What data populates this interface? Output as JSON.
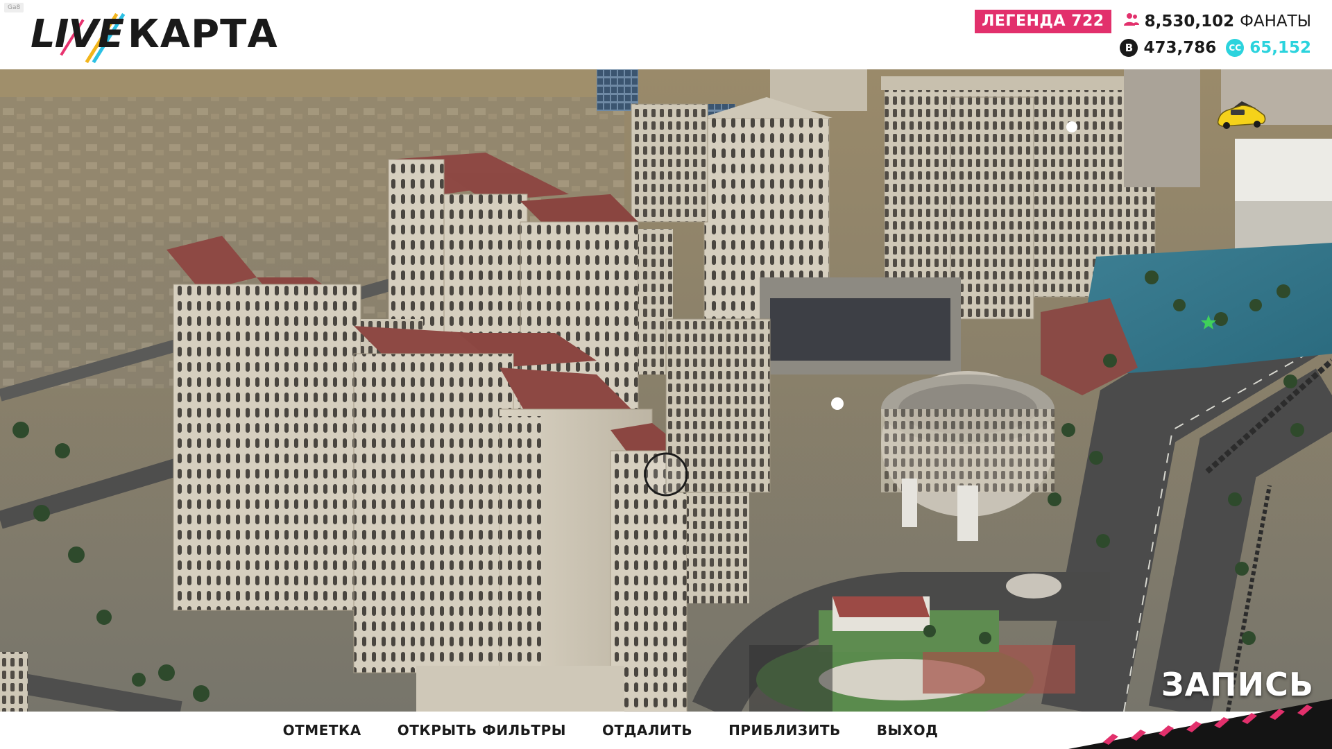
{
  "header": {
    "build_tag": "Ga8",
    "logo": {
      "part1": "LIVE",
      "part2": "КАРТА"
    },
    "legend_badge": "ЛЕГЕНДА 722",
    "fans": {
      "icon": "people-icon",
      "value": "8,530,102",
      "label": "ФАНАТЫ"
    },
    "bucks": {
      "icon": "bucks-coin-icon",
      "value": "473,786"
    },
    "crew_credits": {
      "icon": "cc-coin-icon",
      "badge": "CC",
      "value": "65,152"
    }
  },
  "map": {
    "player_vehicle_icon": "yellow-car-icon",
    "markers": [
      "waypoint-white-dot",
      "waypoint-white-dot",
      "green-star-icon",
      "circle-cursor-icon"
    ],
    "accent_colors": {
      "brand_pink": "#e2306c",
      "cc_cyan": "#2bd3dd",
      "vehicle": "#f5d21a"
    }
  },
  "recording_label": "ЗАПИСЬ",
  "bottom_menu": [
    {
      "label": "ОТМЕТКА"
    },
    {
      "label": "ОТКРЫТЬ ФИЛЬТРЫ"
    },
    {
      "label": "ОТДАЛИТЬ"
    },
    {
      "label": "ПРИБЛИЗИТЬ"
    },
    {
      "label": "ВЫХОД"
    }
  ]
}
